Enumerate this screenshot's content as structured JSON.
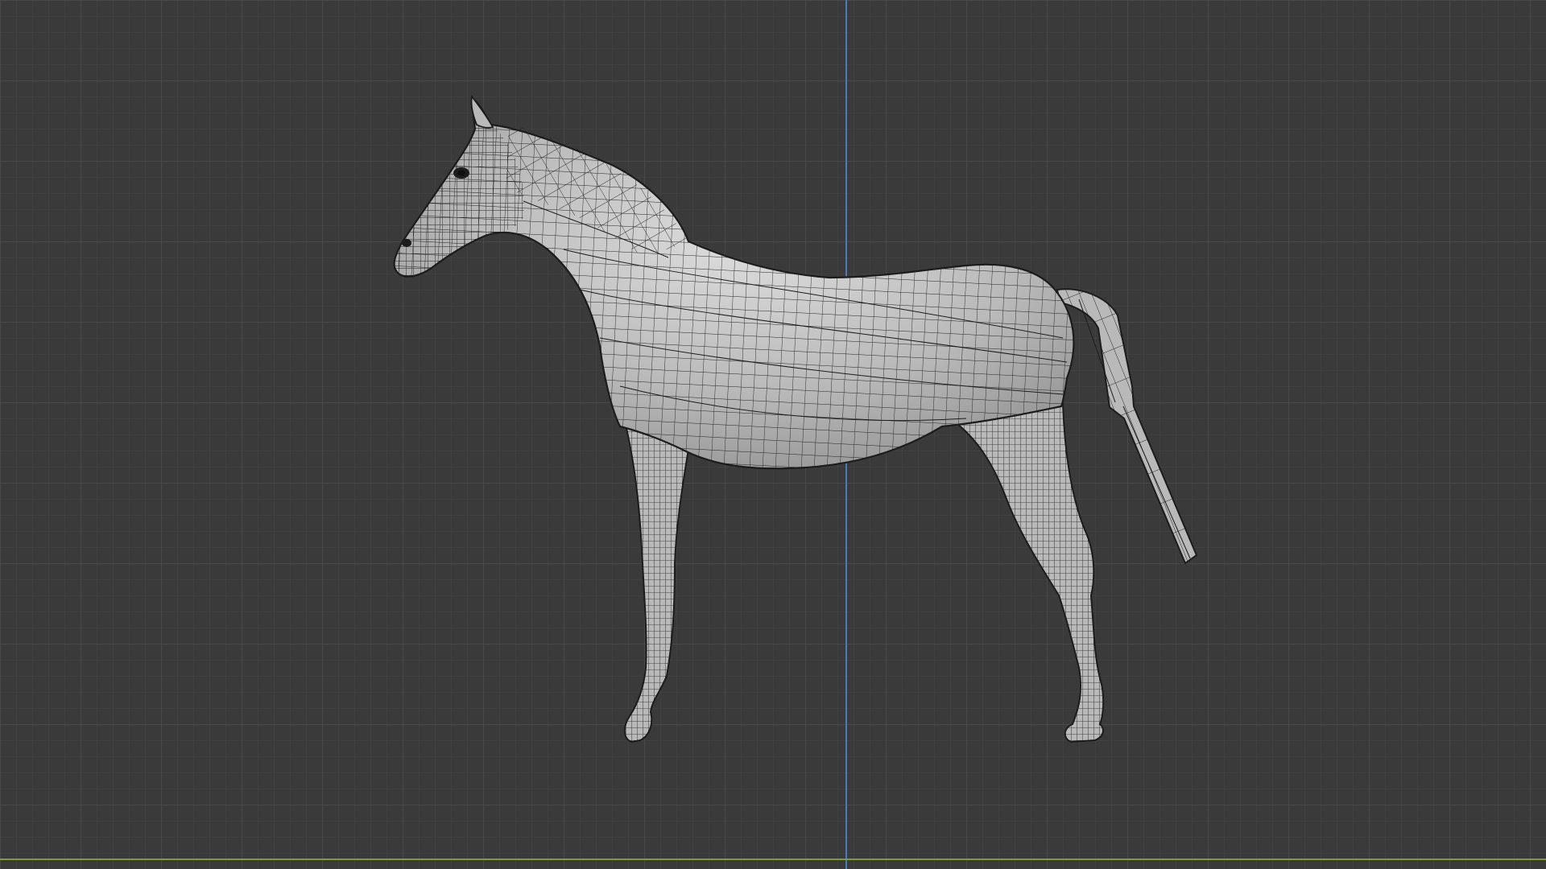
{
  "viewport": {
    "mode": "orthographic-side-view",
    "background_color": "#3a3a3a",
    "grid_minor_color": "#474747",
    "grid_major_color": "#525252",
    "y_axis_color": "#4a79c2",
    "x_axis_color": "#7aa033"
  },
  "object": {
    "name": "horse-mesh",
    "display": "solid-shaded-with-wireframe",
    "base_color": "#b9b9b9",
    "highlight_color": "#dedede",
    "shadow_color": "#8a8a8a",
    "wire_color": "#1c1c1c"
  }
}
